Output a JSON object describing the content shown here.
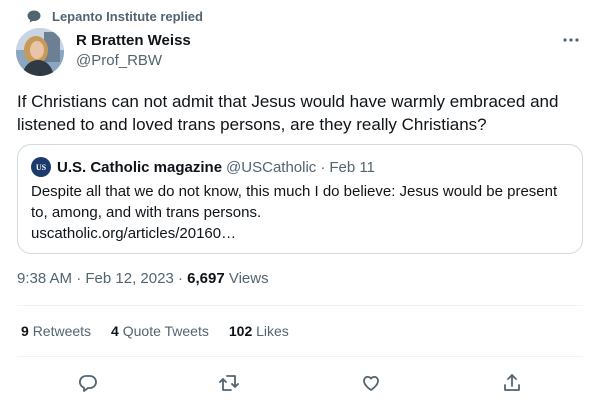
{
  "reply_context": {
    "text": "Lepanto Institute replied",
    "icon": "speech-bubble-icon"
  },
  "author": {
    "name": "R Bratten Weiss",
    "handle": "@Prof_RBW"
  },
  "tweet": {
    "text": "If Christians can not admit that Jesus would have warmly embraced and listened to and loved trans persons, are they really Christians?"
  },
  "quoted": {
    "logo_text": "US",
    "name": "U.S. Catholic magazine",
    "handle": "@USCatholic",
    "separator": "·",
    "date": "Feb 11",
    "text": "Despite all that we do not know, this much I do believe: Jesus would be present to, among, and with trans persons.",
    "link": "uscatholic.org/articles/20160…"
  },
  "meta": {
    "time": "9:38 AM",
    "separator": "·",
    "date": "Feb 12, 2023",
    "views_count": "6,697",
    "views_label": "Views"
  },
  "stats": {
    "retweets_count": "9",
    "retweets_label": "Retweets",
    "quotes_count": "4",
    "quotes_label": "Quote Tweets",
    "likes_count": "102",
    "likes_label": "Likes"
  },
  "actions": [
    "reply-icon",
    "retweet-icon",
    "like-icon",
    "share-icon"
  ],
  "colors": {
    "text": "#0f1419",
    "secondary": "#536471",
    "border": "#cfd9de",
    "divider": "#eff3f4"
  }
}
